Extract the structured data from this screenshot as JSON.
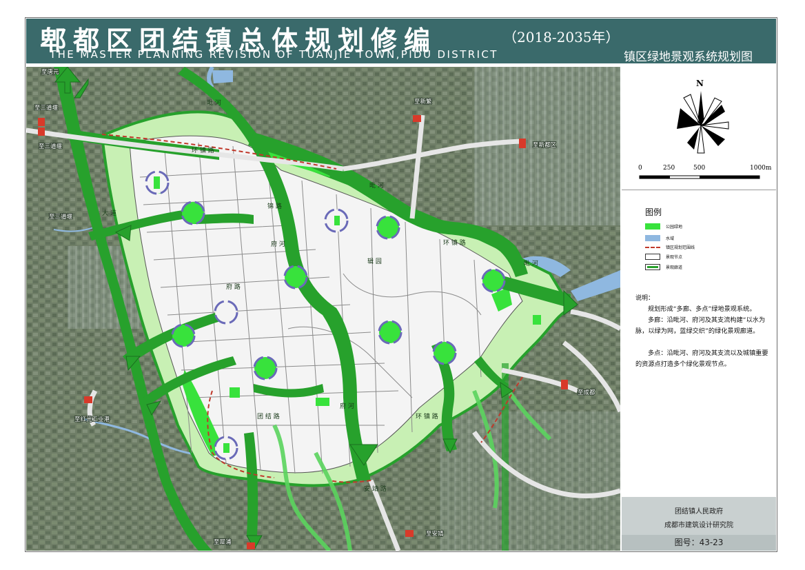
{
  "header": {
    "title_cn": "郫都区团结镇总体规划修编",
    "title_year": "（2018-2035年）",
    "title_en": "THE MASTER PLANNING REVISION OF TUANJIE TOWN,PIDU DISTRICT",
    "drawing_title": "镇区绿地景观系统规划图"
  },
  "compass": {
    "north_label": "N",
    "scale_ticks": [
      "0",
      "250",
      "500",
      "1000m"
    ]
  },
  "legend": {
    "title": "图例",
    "items": [
      {
        "label": "公园绿地",
        "color": "#38e23c"
      },
      {
        "label": "水域",
        "color": "#8fb8e0"
      },
      {
        "label": "镇区规划范围线",
        "color": "#c0392b"
      },
      {
        "label": "景观节点",
        "color": "#ffffff"
      },
      {
        "label": "景观廊道",
        "color": "#27a12c"
      }
    ]
  },
  "notes": {
    "title": "说明：",
    "paragraphs": [
      "规划形成“多廊、多点”绿地景观系统。",
      "多廊：沿毗河、府河及其支流构建“以水为脉，以绿为网，蓝绿交织”的绿化景观廊道。",
      "多点：沿毗河、府河及其支流以及城镇重要的资源点打造多个绿化景观节点。"
    ]
  },
  "footer": {
    "government": "团结镇人民政府",
    "institute": "成都市建筑设计研究院",
    "drawing_number": "图号：43-23"
  },
  "map": {
    "destinations": {
      "tangyuan": "至唐元",
      "sandaoyan_1": "至三道堰",
      "sandaoyan_2": "至三道堰",
      "sandaoyan_3": "至三道堰",
      "xinfan": "至新繁",
      "xindu": "至新都区",
      "chengdu": "至成都",
      "hongguang": "至红光工业港",
      "xipu": "至犀浦",
      "anjing": "至安靖"
    },
    "road_labels": {
      "pi_he_north": "毗 河",
      "pi_he_east": "毗 河",
      "pi_he_far": "毗 河",
      "fu_he_1": "府 河",
      "fu_he_2": "府 河",
      "ring_north": "环 镇 路",
      "ring_east": "环 镇 路",
      "ring_south": "环 镇 路",
      "jin_lu": "锦 路",
      "tuanjie_rd": "团 结 路",
      "avenue": "大 道",
      "tong_yuan": "辑 园",
      "fu_lu": "府 路",
      "an_lu": "安 靖 路"
    },
    "colors": {
      "satellite": "#6e7d66",
      "urban_block": "#f4f4f4",
      "park_green": "#38e23c",
      "light_green": "#c8f0b4",
      "corridor": "#27a12c",
      "water": "#8fb8e0",
      "boundary": "#c0392b"
    }
  }
}
